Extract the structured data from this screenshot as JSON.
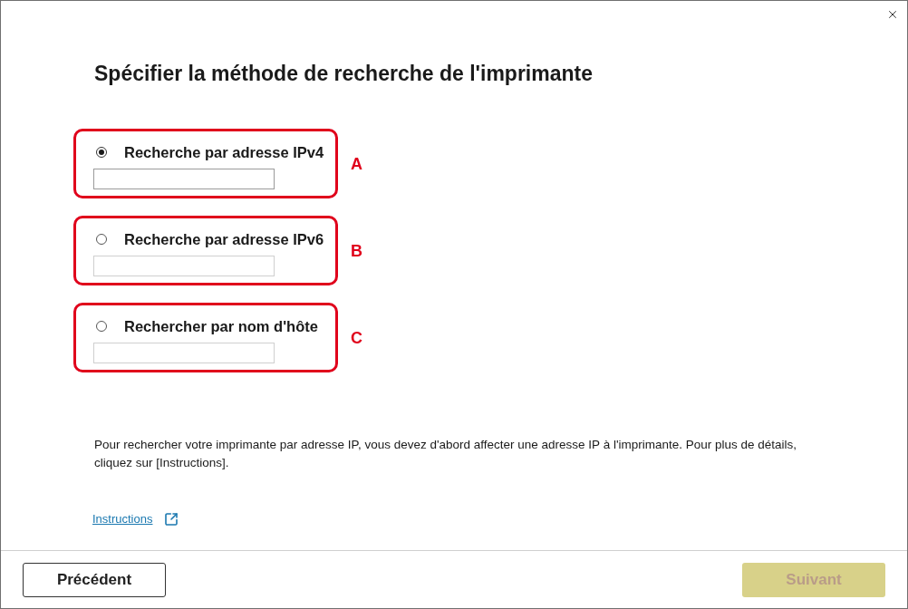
{
  "title": "Spécifier la méthode de recherche de l'imprimante",
  "options": [
    {
      "label": "Recherche par adresse IPv4",
      "selected": true,
      "field_disabled": false,
      "callout": "A"
    },
    {
      "label": "Recherche par adresse IPv6",
      "selected": false,
      "field_disabled": true,
      "callout": "B"
    },
    {
      "label": "Rechercher par nom d'hôte",
      "selected": false,
      "field_disabled": true,
      "callout": "C"
    }
  ],
  "note": "Pour rechercher votre imprimante par adresse IP, vous devez d'abord affecter une adresse IP à l'imprimante. Pour plus de détails, cliquez sur [Instructions].",
  "instructions_link": "Instructions",
  "buttons": [
    {
      "label": "Précédent",
      "kind": "back",
      "disabled": false
    },
    {
      "label": "Suivant",
      "kind": "next",
      "disabled": true
    }
  ]
}
